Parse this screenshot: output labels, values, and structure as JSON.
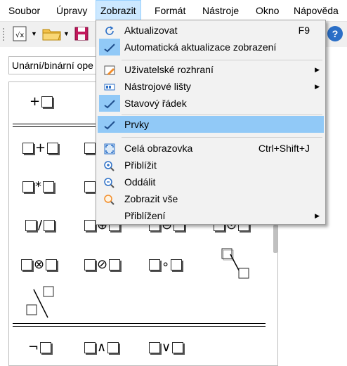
{
  "menubar": {
    "items": [
      {
        "label": "Soubor"
      },
      {
        "label": "Úpravy"
      },
      {
        "label": "Zobrazit"
      },
      {
        "label": "Formát"
      },
      {
        "label": "Nástroje"
      },
      {
        "label": "Okno"
      },
      {
        "label": "Nápověda"
      }
    ]
  },
  "toolbar": {
    "help_label": "?"
  },
  "combo": {
    "value": "Unární/binární ope"
  },
  "elements": {
    "rows": [
      [
        "+",
        "",
        "",
        ""
      ],
      [
        "+",
        "",
        "",
        ""
      ],
      [
        "*",
        "",
        "",
        ""
      ],
      [
        "/",
        "⊕",
        "⊖",
        "⊙"
      ],
      [
        "⊗",
        "⊘",
        "∘",
        ""
      ],
      [
        "¬",
        "∧",
        "∨",
        ""
      ]
    ]
  },
  "menu": {
    "items": [
      {
        "label": "Aktualizovat",
        "shortcut": "F9",
        "icon": "refresh-icon"
      },
      {
        "label": "Automatická aktualizace zobrazení",
        "shortcut": "",
        "icon": "check-icon",
        "checked": true
      },
      {
        "label": "Uživatelské rozhraní",
        "shortcut": "",
        "icon": "ui-icon",
        "submenu": true
      },
      {
        "label": "Nástrojové lišty",
        "shortcut": "",
        "icon": "toolbar-icon",
        "submenu": true
      },
      {
        "label": "Stavový řádek",
        "shortcut": "",
        "icon": "check-icon",
        "checked": true
      },
      {
        "label": "Prvky",
        "shortcut": "",
        "icon": "check-icon",
        "checked": true,
        "highlighted": true
      },
      {
        "label": "Celá obrazovka",
        "shortcut": "Ctrl+Shift+J",
        "icon": "fullscreen-icon"
      },
      {
        "label": "Přiblížit",
        "shortcut": "",
        "icon": "zoom-in-icon"
      },
      {
        "label": "Oddálit",
        "shortcut": "",
        "icon": "zoom-out-icon"
      },
      {
        "label": "Zobrazit vše",
        "shortcut": "",
        "icon": "zoom-all-icon"
      },
      {
        "label": "Přiblížení",
        "shortcut": "",
        "icon": "",
        "submenu": true
      }
    ]
  },
  "colors": {
    "highlight": "#91c9f7",
    "menubar_active": "#cce8ff"
  }
}
